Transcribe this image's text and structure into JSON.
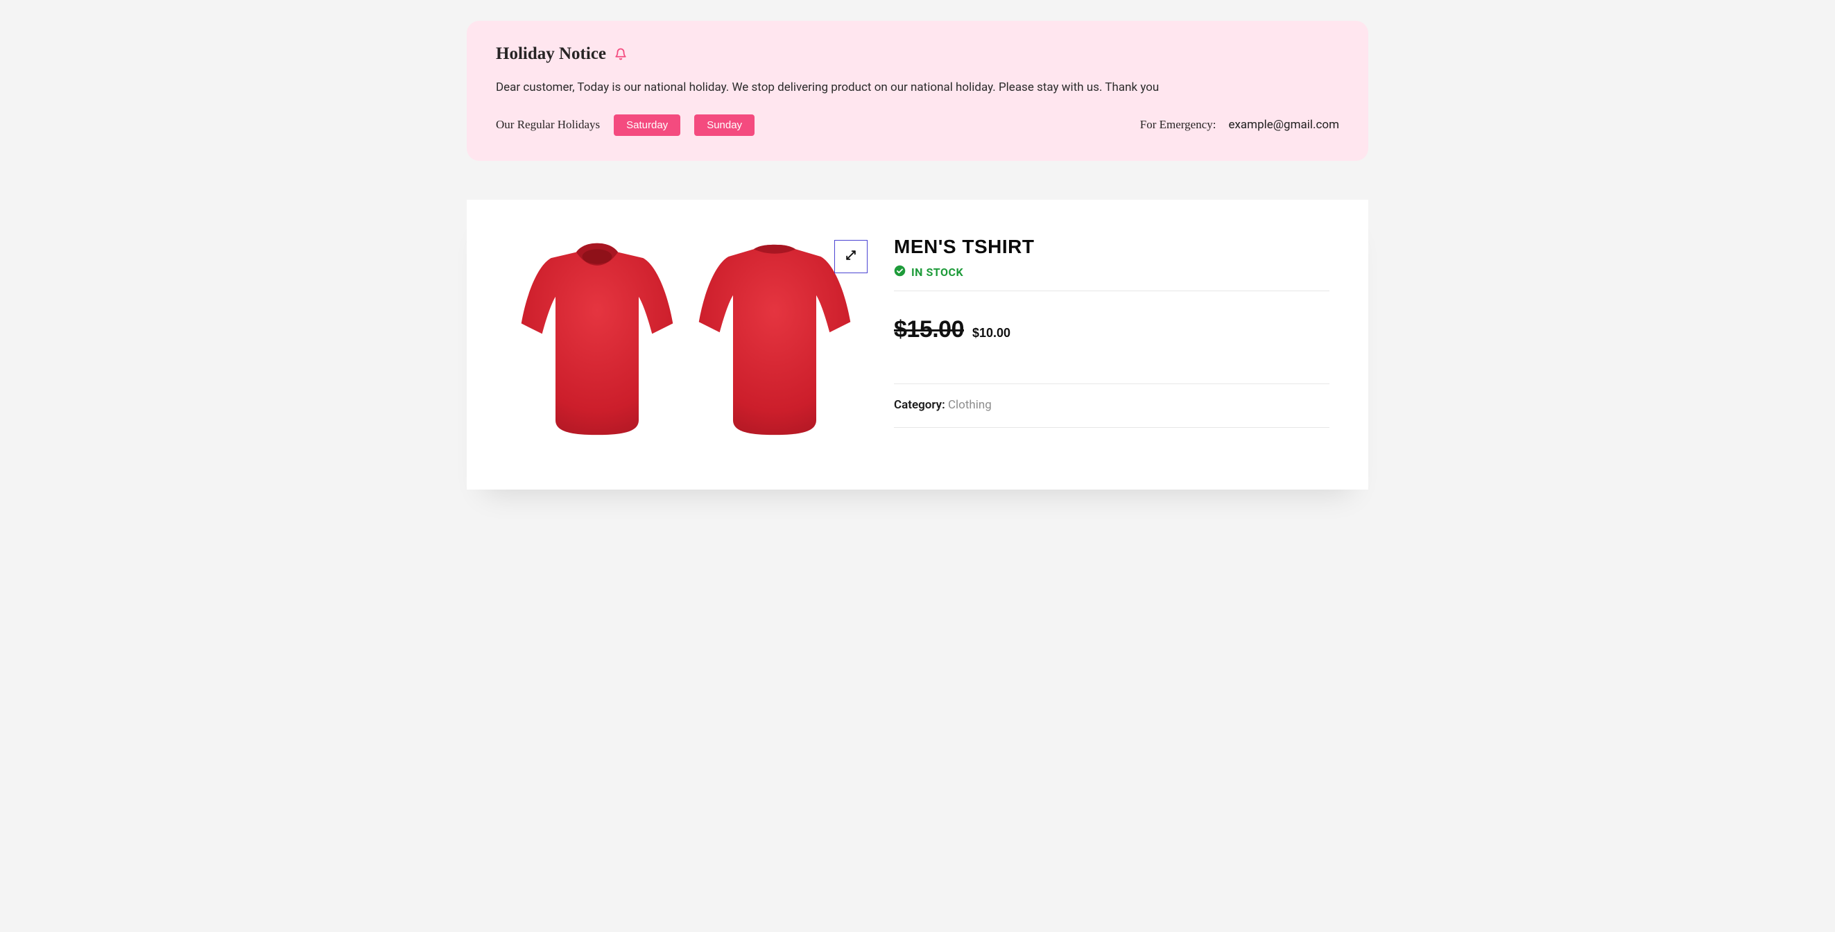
{
  "notice": {
    "title": "Holiday Notice",
    "body": "Dear customer, Today is our national holiday. We stop delivering product on our national holiday. Please stay with us. Thank you",
    "regular_label": "Our Regular Holidays",
    "days": [
      "Saturday",
      "Sunday"
    ],
    "emergency_label": "For Emergency:",
    "emergency_email": "example@gmail.com"
  },
  "product": {
    "title": "MEN'S TSHIRT",
    "stock_status": "IN STOCK",
    "price_old": "$15.00",
    "price_new": "$10.00",
    "category_label": "Category:",
    "category_value": "Clothing"
  },
  "colors": {
    "notice_bg": "#ffe6ef",
    "pill_bg": "#f44b7f",
    "stock_green": "#1e9b3a",
    "tshirt_red": "#cc1e2b"
  }
}
